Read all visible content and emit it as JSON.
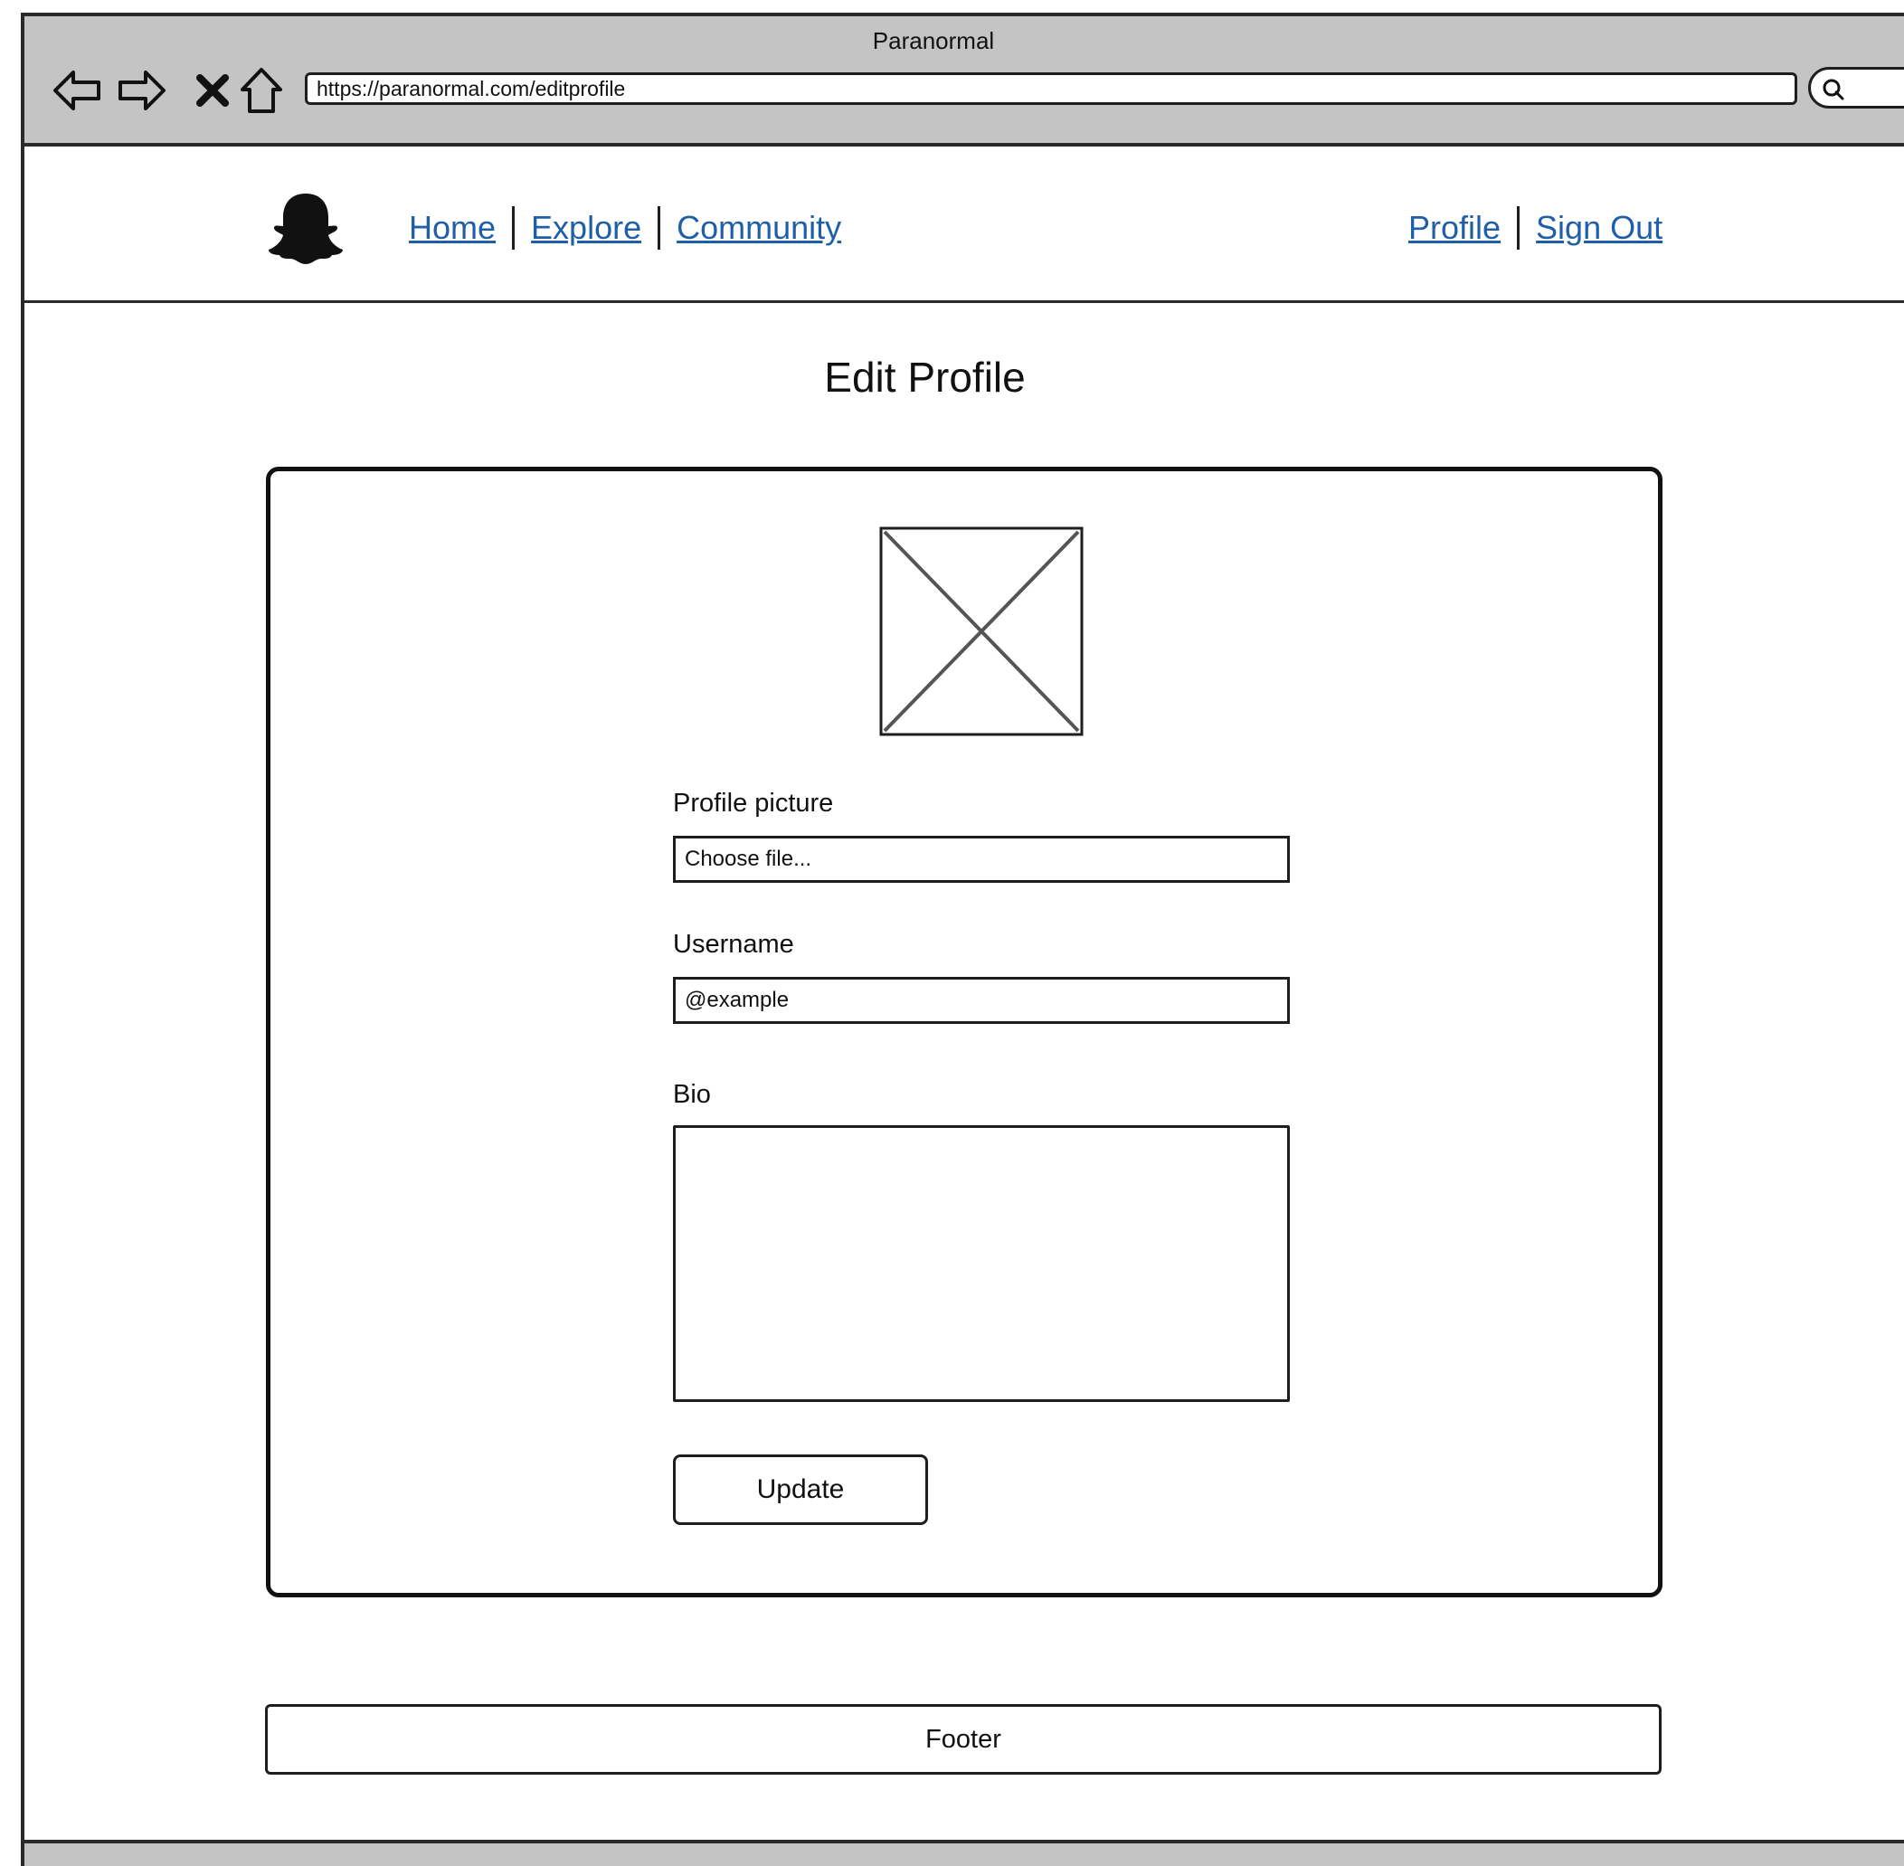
{
  "browser": {
    "window_title": "Paranormal",
    "url": "https://paranormal.com/editprofile",
    "nav_icons": [
      "back-arrow-icon",
      "forward-arrow-icon",
      "stop-icon",
      "home-icon"
    ],
    "search_icon": "search-icon"
  },
  "header": {
    "logo_icon": "ghost-icon",
    "nav_left": [
      "Home",
      "Explore",
      "Community"
    ],
    "nav_right": [
      "Profile",
      "Sign Out"
    ],
    "link_color": "#1f5fa8"
  },
  "main": {
    "title": "Edit Profile",
    "avatar_icon": "image-placeholder-icon",
    "fields": {
      "profile_picture": {
        "label": "Profile picture",
        "value": "Choose file..."
      },
      "username": {
        "label": "Username",
        "value": "@example"
      },
      "bio": {
        "label": "Bio",
        "value": ""
      }
    },
    "update_label": "Update"
  },
  "footer": {
    "label": "Footer"
  }
}
